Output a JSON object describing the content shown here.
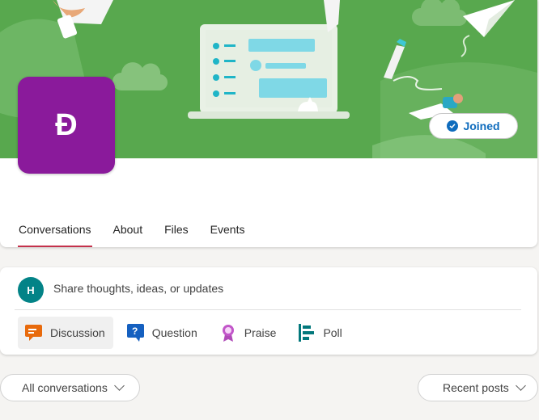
{
  "colors": {
    "banner": "#58a84e",
    "logo": "#8a1a9b",
    "accent": "#0f6cbd",
    "tab_underline": "#c4314b",
    "avatar": "#038387"
  },
  "group": {
    "logo_letter": "Đ",
    "joined_label": "Joined"
  },
  "tabs": [
    {
      "label": "Conversations",
      "active": true
    },
    {
      "label": "About"
    },
    {
      "label": "Files"
    },
    {
      "label": "Events"
    }
  ],
  "composer": {
    "avatar_initial": "H",
    "placeholder": "Share thoughts, ideas, or updates",
    "post_types": [
      {
        "label": "Discussion",
        "icon": "discussion-icon",
        "selected": true
      },
      {
        "label": "Question",
        "icon": "question-icon"
      },
      {
        "label": "Praise",
        "icon": "praise-icon"
      },
      {
        "label": "Poll",
        "icon": "poll-icon"
      }
    ]
  },
  "filters": {
    "conversations": "All conversations",
    "sort": "Recent posts"
  }
}
